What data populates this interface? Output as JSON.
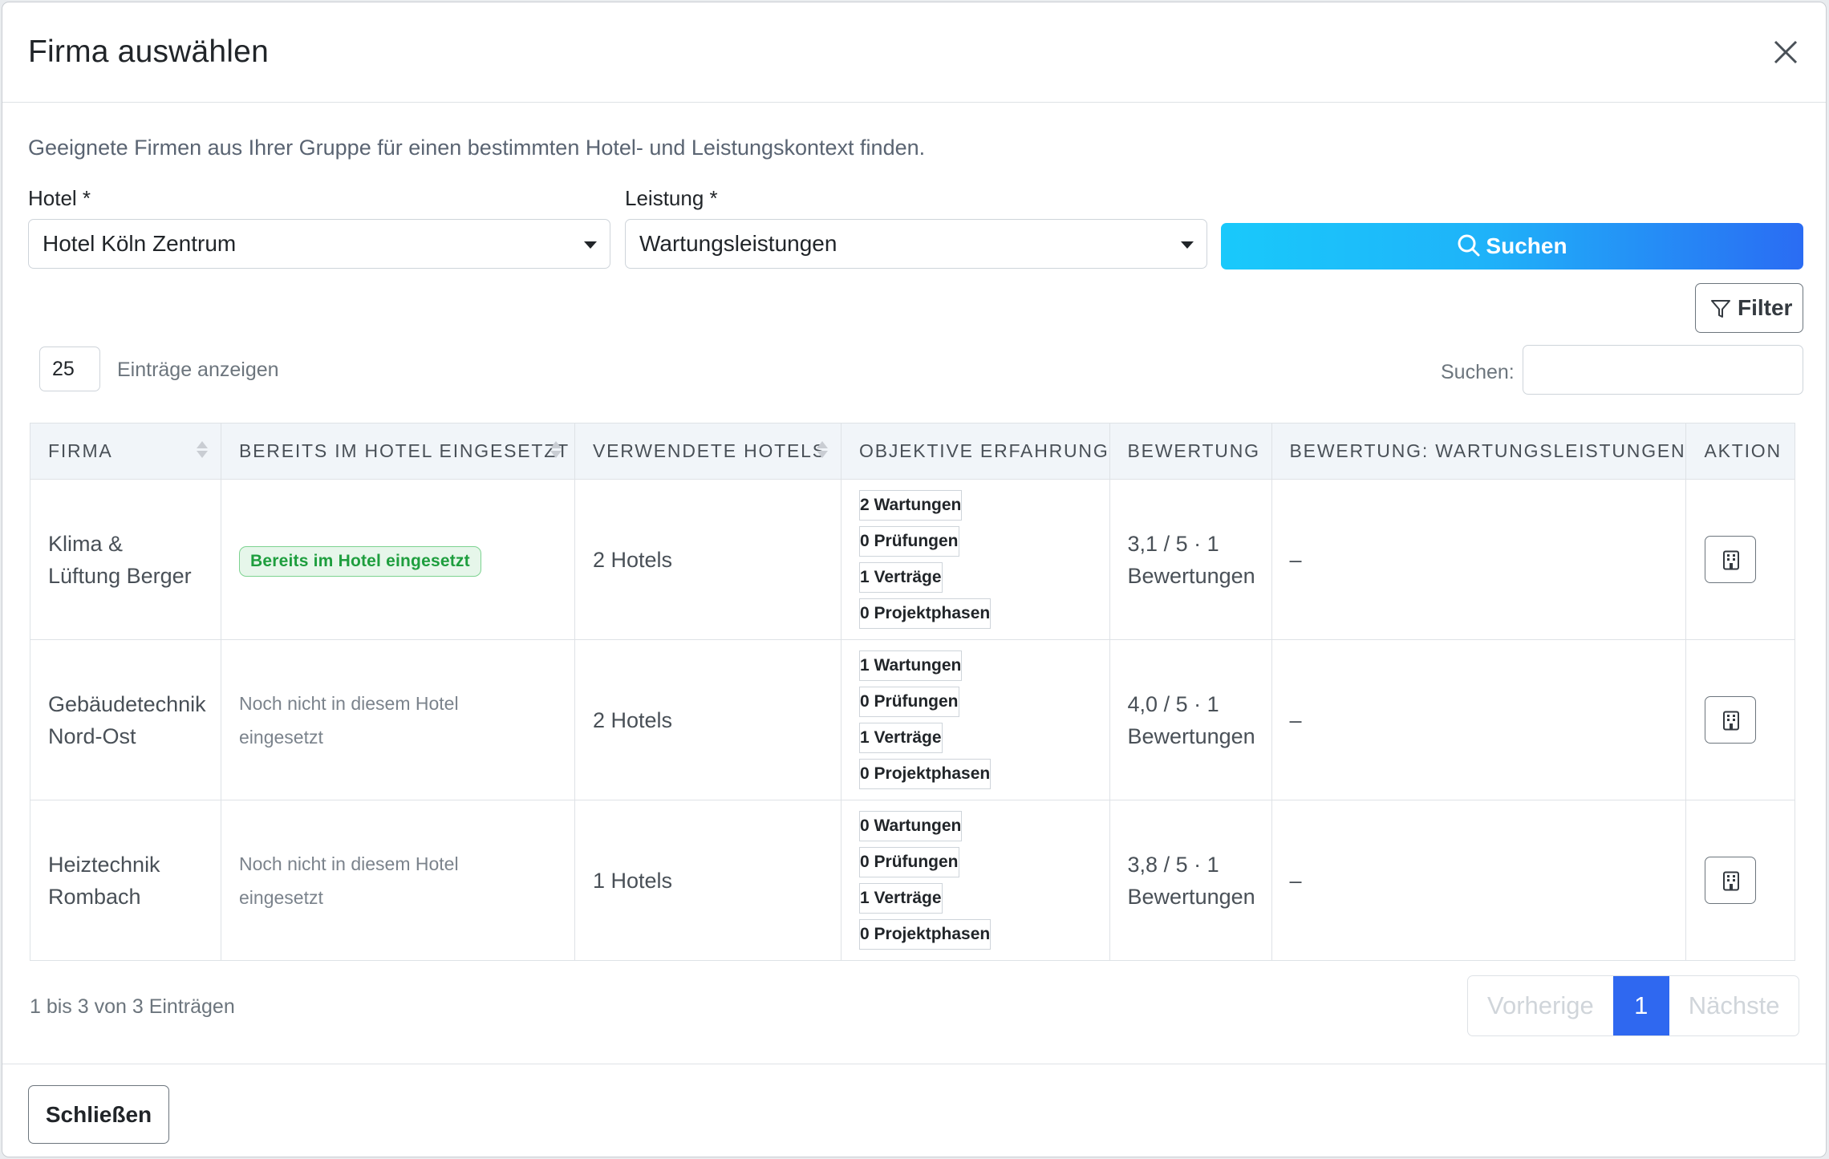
{
  "modal": {
    "title": "Firma auswählen"
  },
  "intro": "Geeignete Firmen aus Ihrer Gruppe für einen bestimmten Hotel- und Leistungskontext finden.",
  "form": {
    "hotel_label": "Hotel *",
    "hotel_value": "Hotel Köln Zentrum",
    "service_label": "Leistung *",
    "service_value": "Wartungsleistungen",
    "search_button": "Suchen",
    "filter_button": "Filter"
  },
  "table_controls": {
    "page_length": "25",
    "page_length_label": "Einträge anzeigen",
    "search_label": "Suchen:"
  },
  "columns": [
    "FIRMA",
    "BEREITS IM HOTEL EINGESETZT",
    "VERWENDETE HOTELS",
    "OBJEKTIVE ERFAHRUNG",
    "BEWERTUNG",
    "BEWERTUNG: WARTUNGSLEISTUNGEN",
    "AKTION"
  ],
  "rows": [
    {
      "firma_line1": "Klima &",
      "firma_line2": "Lüftung Berger",
      "status": "Bereits im Hotel eingesetzt",
      "hotels": "2 Hotels",
      "chips": [
        "2 Wartungen",
        "0 Prüfungen",
        "1 Verträge",
        "0 Projektphasen"
      ],
      "rating_line1": "3,1 / 5 · 1",
      "rating_line2": "Bewertungen",
      "service_rating": "–"
    },
    {
      "firma_line1": "Gebäudetechnik",
      "firma_line2": "Nord-Ost",
      "status_line1": "Noch nicht in diesem Hotel",
      "status_line2": "eingesetzt",
      "hotels": "2 Hotels",
      "chips": [
        "1 Wartungen",
        "0 Prüfungen",
        "1 Verträge",
        "0 Projektphasen"
      ],
      "rating_line1": "4,0 / 5 · 1",
      "rating_line2": "Bewertungen",
      "service_rating": "–"
    },
    {
      "firma_line1": "Heiztechnik",
      "firma_line2": "Rombach",
      "status_line1": "Noch nicht in diesem Hotel",
      "status_line2": "eingesetzt",
      "hotels": "1 Hotels",
      "chips": [
        "0 Wartungen",
        "0 Prüfungen",
        "1 Verträge",
        "0 Projektphasen"
      ],
      "rating_line1": "3,8 / 5 · 1",
      "rating_line2": "Bewertungen",
      "service_rating": "–"
    }
  ],
  "footer_info": "1 bis 3 von 3 Einträgen",
  "pagination": {
    "prev": "Vorherige",
    "current": "1",
    "next": "Nächste"
  },
  "footer": {
    "close_button": "Schließen"
  },
  "colors": {
    "accent": "#2f68f0",
    "search_gradient_start": "#19c9fb",
    "search_gradient_end": "#2a6cf3",
    "success": "#1e9e3e"
  },
  "icons": {
    "close": "close-icon",
    "search": "search-icon",
    "filter": "filter-icon",
    "action": "building-icon"
  }
}
